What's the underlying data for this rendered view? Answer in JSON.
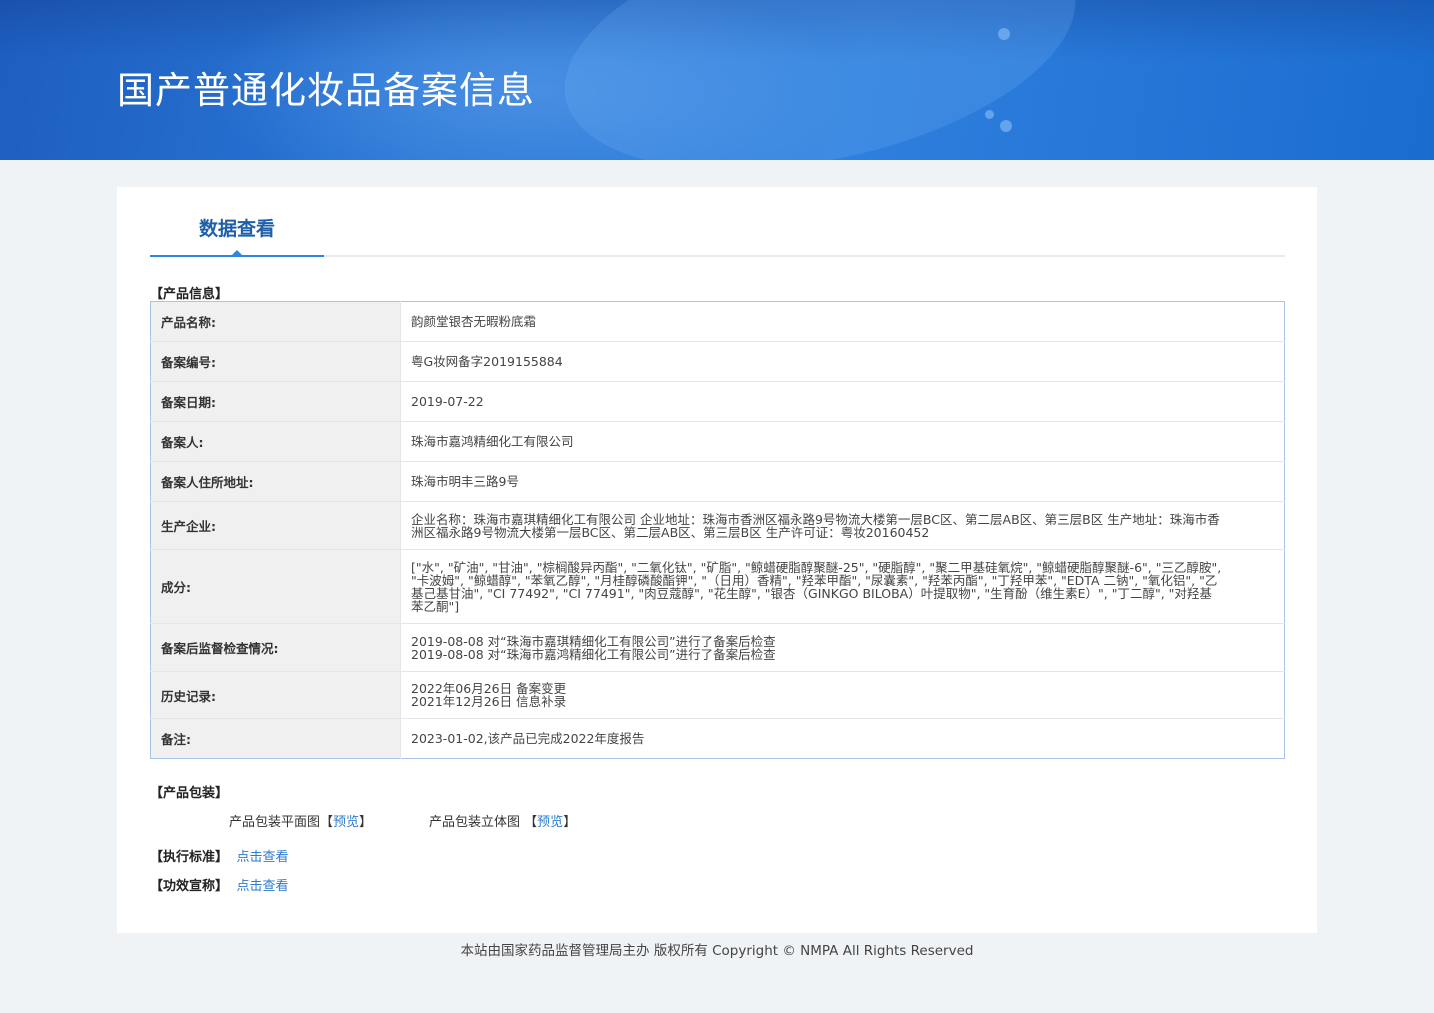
{
  "header": {
    "title": "国产普通化妆品备案信息"
  },
  "tabs": [
    {
      "label": "数据查看"
    }
  ],
  "sections": {
    "product_info": "【产品信息】",
    "product_package": "【产品包装】",
    "exec_standard": "【执行标准】",
    "efficacy_claim": "【功效宣称】"
  },
  "product_info": [
    {
      "label": "产品名称:",
      "value": "韵颜堂银杏无暇粉底霜"
    },
    {
      "label": "备案编号:",
      "value": "粤G妆网备字2019155884"
    },
    {
      "label": "备案日期:",
      "value": "2019-07-22"
    },
    {
      "label": "备案人:",
      "value": "珠海市嘉鸿精细化工有限公司"
    },
    {
      "label": "备案人住所地址:",
      "value": "珠海市明丰三路9号"
    },
    {
      "label": "生产企业:",
      "value": "企业名称：珠海市嘉琪精细化工有限公司 企业地址：珠海市香洲区福永路9号物流大楼第一层BC区、第二层AB区、第三层B区 生产地址：珠海市香洲区福永路9号物流大楼第一层BC区、第二层AB区、第三层B区 生产许可证：粤妆20160452"
    },
    {
      "label": "成分:",
      "value": "[\"水\", \"矿油\", \"甘油\", \"棕榈酸异丙酯\", \"二氧化钛\", \"矿脂\", \"鲸蜡硬脂醇聚醚-25\", \"硬脂醇\", \"聚二甲基硅氧烷\", \"鲸蜡硬脂醇聚醚-6\", \"三乙醇胺\", \"卡波姆\", \"鲸蜡醇\", \"苯氧乙醇\", \"月桂醇磷酸酯钾\", \"（日用）香精\", \"羟苯甲酯\", \"尿囊素\", \"羟苯丙酯\", \"丁羟甲苯\", \"EDTA 二钠\", \"氧化铝\", \"乙基己基甘油\", \"CI 77492\", \"CI 77491\", \"肉豆蔻醇\", \"花生醇\", \"银杏（GINKGO BILOBA）叶提取物\", \"生育酚（维生素E）\", \"丁二醇\", \"对羟基苯乙酮\"]"
    },
    {
      "label": "备案后监督检查情况:",
      "value": "2019-08-08 对“珠海市嘉琪精细化工有限公司”进行了备案后检查\n2019-08-08 对“珠海市嘉鸿精细化工有限公司”进行了备案后检查"
    },
    {
      "label": "历史记录:",
      "value": "2022年06月26日 备案变更\n2021年12月26日 信息补录"
    },
    {
      "label": "备注:",
      "value": "2023-01-02,该产品已完成2022年度报告"
    }
  ],
  "package": {
    "flat_label": "产品包装平面图",
    "stereo_label": "产品包装立体图",
    "preview": "预览",
    "bracket_open": "【",
    "bracket_close": "】"
  },
  "links": {
    "view": "点击查看"
  },
  "footer": {
    "text": "本站由国家药品监督管理局主办 版权所有 Copyright © NMPA All Rights Reserved"
  }
}
